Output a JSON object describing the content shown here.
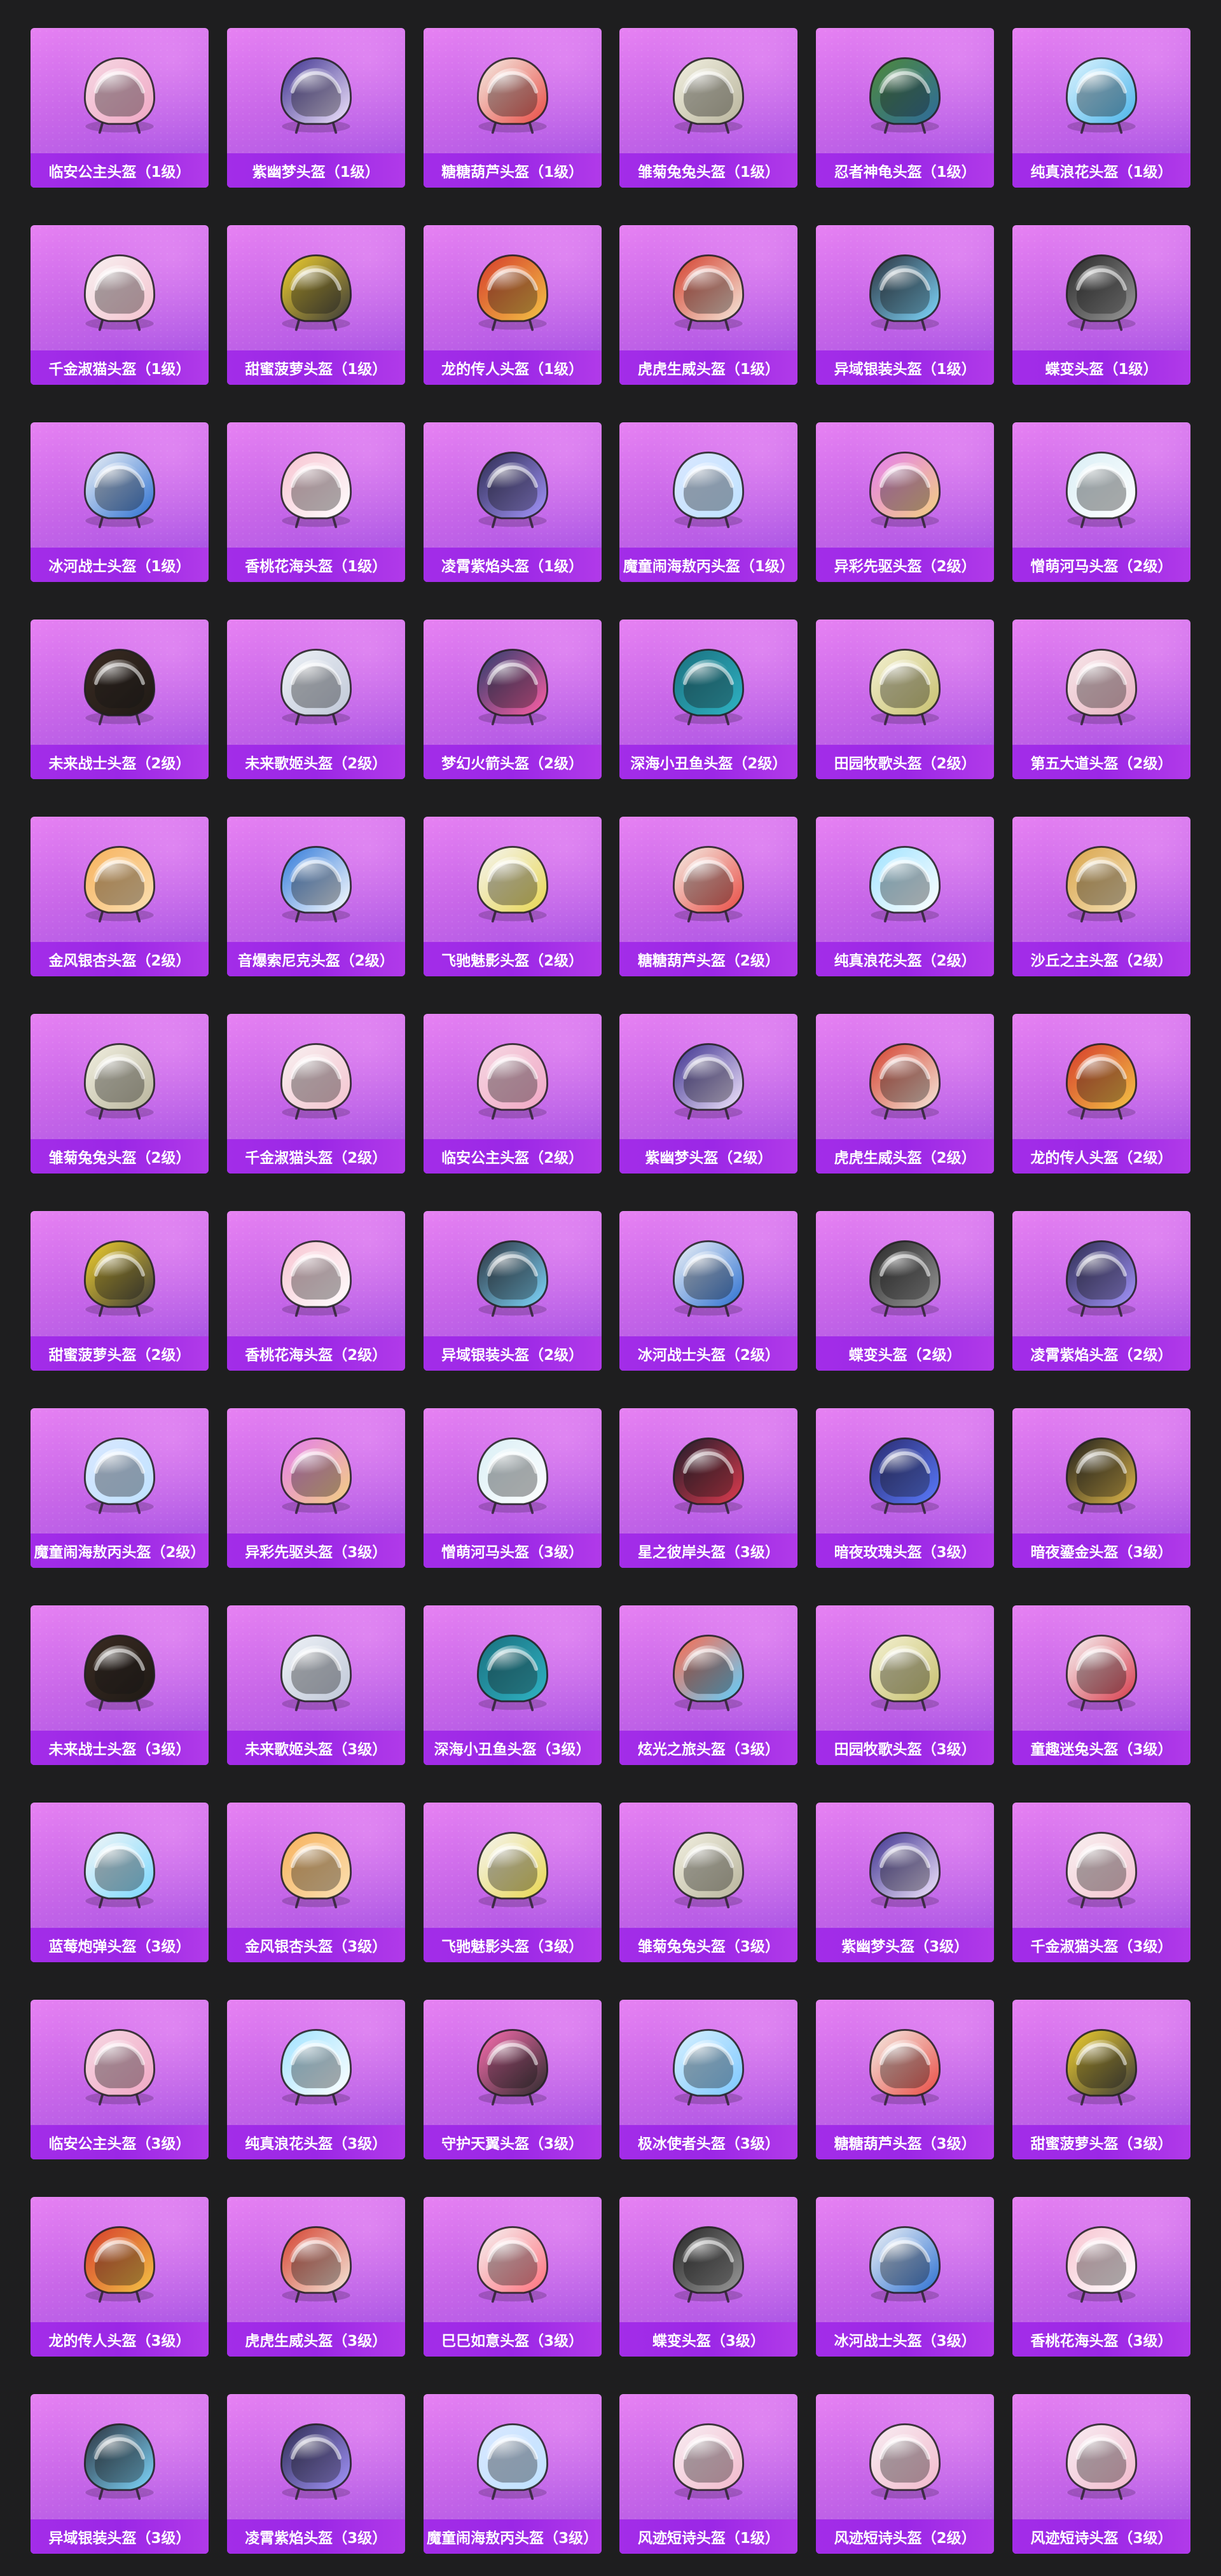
{
  "cards": [
    {
      "label": "临安公主头盔（1级）",
      "icon": "helmet-icon",
      "colors": [
        "#f6d8e3",
        "#f0a7c4"
      ]
    },
    {
      "label": "紫幽梦头盔（1级）",
      "icon": "helmet-icon",
      "colors": [
        "#3b2f8d",
        "#f3e7ff"
      ]
    },
    {
      "label": "糖糖葫芦头盔（1级）",
      "icon": "helmet-icon",
      "colors": [
        "#f4efe7",
        "#e94b43"
      ]
    },
    {
      "label": "雏菊兔兔头盔（1级）",
      "icon": "helmet-icon",
      "colors": [
        "#f2f0e1",
        "#b8b49c"
      ]
    },
    {
      "label": "忍者神龟头盔（1级）",
      "icon": "helmet-icon",
      "colors": [
        "#4f8a3a",
        "#2e6b9d"
      ]
    },
    {
      "label": "纯真浪花头盔（1级）",
      "icon": "helmet-icon",
      "colors": [
        "#dff5ff",
        "#4bb4ea"
      ]
    },
    {
      "label": "千金淑猫头盔（1级）",
      "icon": "helmet-icon",
      "colors": [
        "#f8f1f1",
        "#f4c3cf"
      ]
    },
    {
      "label": "甜蜜菠萝头盔（1级）",
      "icon": "helmet-icon",
      "colors": [
        "#f2d12d",
        "#3a3a3a"
      ]
    },
    {
      "label": "龙的传人头盔（1级）",
      "icon": "helmet-icon",
      "colors": [
        "#d63a2c",
        "#f3c545"
      ]
    },
    {
      "label": "虎虎生威头盔（1级）",
      "icon": "helmet-icon",
      "colors": [
        "#d43f2d",
        "#f5e9dc"
      ]
    },
    {
      "label": "异域银装头盔（1级）",
      "icon": "helmet-icon",
      "colors": [
        "#2a2f3a",
        "#7fd9ff"
      ]
    },
    {
      "label": "蝶变头盔（1级）",
      "icon": "helmet-icon",
      "colors": [
        "#262626",
        "#9a9a9a"
      ]
    },
    {
      "label": "冰河战士头盔（1级）",
      "icon": "helmet-icon",
      "colors": [
        "#f1f4f7",
        "#2b6fd1"
      ]
    },
    {
      "label": "香桃花海头盔（1级）",
      "icon": "helmet-icon",
      "colors": [
        "#f7c3d0",
        "#ffffff"
      ]
    },
    {
      "label": "凌霄紫焰头盔（1级）",
      "icon": "helmet-icon",
      "colors": [
        "#2b2a4e",
        "#a596ff"
      ]
    },
    {
      "label": "魔童闹海敖丙头盔（1级）",
      "icon": "helmet-icon",
      "colors": [
        "#d9e7ff",
        "#bfe2ff"
      ]
    },
    {
      "label": "异彩先驱头盔（2级）",
      "icon": "helmet-icon",
      "colors": [
        "#e57df0",
        "#f2d17f"
      ]
    },
    {
      "label": "憎萌河马头盔（2级）",
      "icon": "helmet-icon",
      "colors": [
        "#d9eef5",
        "#ffffff"
      ]
    },
    {
      "label": "未来战士头盔（2级）",
      "icon": "helmet-icon",
      "colors": [
        "#3a2b22",
        "#1f1a16"
      ]
    },
    {
      "label": "未来歌姬头盔（2级）",
      "icon": "helmet-icon",
      "colors": [
        "#eef2f7",
        "#bfc7d7"
      ]
    },
    {
      "label": "梦幻火箭头盔（2级）",
      "icon": "helmet-icon",
      "colors": [
        "#2a3c6b",
        "#ff5fa5"
      ]
    },
    {
      "label": "深海小丑鱼头盔（2级）",
      "icon": "helmet-icon",
      "colors": [
        "#1a6f7e",
        "#2fb4c5"
      ]
    },
    {
      "label": "田园牧歌头盔（2级）",
      "icon": "helmet-icon",
      "colors": [
        "#f4f1d3",
        "#c7c06e"
      ]
    },
    {
      "label": "第五大道头盔（2级）",
      "icon": "helmet-icon",
      "colors": [
        "#f7e6ea",
        "#e7b3bf"
      ]
    },
    {
      "label": "金风银杏头盔（2级）",
      "icon": "helmet-icon",
      "colors": [
        "#f7b15b",
        "#fbe1b4"
      ]
    },
    {
      "label": "音爆索尼克头盔（2级）",
      "icon": "helmet-icon",
      "colors": [
        "#2e78d9",
        "#ffffff"
      ]
    },
    {
      "label": "飞驰魅影头盔（2级）",
      "icon": "helmet-icon",
      "colors": [
        "#f5f5f5",
        "#e8d64f"
      ]
    },
    {
      "label": "糖糖葫芦头盔（2级）",
      "icon": "helmet-icon",
      "colors": [
        "#f4efe7",
        "#e94b43"
      ]
    },
    {
      "label": "纯真浪花头盔（2级）",
      "icon": "helmet-icon",
      "colors": [
        "#9fe2ff",
        "#ffffff"
      ]
    },
    {
      "label": "沙丘之主头盔（2级）",
      "icon": "helmet-icon",
      "colors": [
        "#d9a44b",
        "#f5e2b8"
      ]
    },
    {
      "label": "雏菊兔兔头盔（2级）",
      "icon": "helmet-icon",
      "colors": [
        "#f2f0e1",
        "#b8b49c"
      ]
    },
    {
      "label": "千金淑猫头盔（2级）",
      "icon": "helmet-icon",
      "colors": [
        "#f8f1f1",
        "#f4c3cf"
      ]
    },
    {
      "label": "临安公主头盔（2级）",
      "icon": "helmet-icon",
      "colors": [
        "#f6d8e3",
        "#f0a7c4"
      ]
    },
    {
      "label": "紫幽梦头盔（2级）",
      "icon": "helmet-icon",
      "colors": [
        "#3b2f8d",
        "#f3e7ff"
      ]
    },
    {
      "label": "虎虎生威头盔（2级）",
      "icon": "helmet-icon",
      "colors": [
        "#d43f2d",
        "#f5e9dc"
      ]
    },
    {
      "label": "龙的传人头盔（2级）",
      "icon": "helmet-icon",
      "colors": [
        "#d63a2c",
        "#f3c545"
      ]
    },
    {
      "label": "甜蜜菠萝头盔（2级）",
      "icon": "helmet-icon",
      "colors": [
        "#f2d12d",
        "#3a3a3a"
      ]
    },
    {
      "label": "香桃花海头盔（2级）",
      "icon": "helmet-icon",
      "colors": [
        "#f7c3d0",
        "#ffffff"
      ]
    },
    {
      "label": "异域银装头盔（2级）",
      "icon": "helmet-icon",
      "colors": [
        "#2a2f3a",
        "#7fd9ff"
      ]
    },
    {
      "label": "冰河战士头盔（2级）",
      "icon": "helmet-icon",
      "colors": [
        "#f1f4f7",
        "#2b6fd1"
      ]
    },
    {
      "label": "蝶变头盔（2级）",
      "icon": "helmet-icon",
      "colors": [
        "#262626",
        "#9a9a9a"
      ]
    },
    {
      "label": "凌霄紫焰头盔（2级）",
      "icon": "helmet-icon",
      "colors": [
        "#2b2a4e",
        "#a596ff"
      ]
    },
    {
      "label": "魔童闹海敖丙头盔（2级）",
      "icon": "helmet-icon",
      "colors": [
        "#d9e7ff",
        "#bfe2ff"
      ]
    },
    {
      "label": "异彩先驱头盔（3级）",
      "icon": "helmet-icon",
      "colors": [
        "#e57df0",
        "#f2d17f"
      ]
    },
    {
      "label": "憎萌河马头盔（3级）",
      "icon": "helmet-icon",
      "colors": [
        "#d9eef5",
        "#ffffff"
      ]
    },
    {
      "label": "星之彼岸头盔（3级）",
      "icon": "helmet-icon",
      "colors": [
        "#1d1c2a",
        "#e03b4f"
      ]
    },
    {
      "label": "暗夜玫瑰头盔（3级）",
      "icon": "helmet-icon",
      "colors": [
        "#2a2a6d",
        "#5a7bff"
      ]
    },
    {
      "label": "暗夜鎏金头盔（3级）",
      "icon": "helmet-icon",
      "colors": [
        "#1b1b1b",
        "#e1b94a"
      ]
    },
    {
      "label": "未来战士头盔（3级）",
      "icon": "helmet-icon",
      "colors": [
        "#3a2b22",
        "#1f1a16"
      ]
    },
    {
      "label": "未来歌姬头盔（3级）",
      "icon": "helmet-icon",
      "colors": [
        "#eef2f7",
        "#bfc7d7"
      ]
    },
    {
      "label": "深海小丑鱼头盔（3级）",
      "icon": "helmet-icon",
      "colors": [
        "#1a6f7e",
        "#2fb4c5"
      ]
    },
    {
      "label": "炫光之旅头盔（3级）",
      "icon": "helmet-icon",
      "colors": [
        "#ff6a4d",
        "#5fd0ff"
      ]
    },
    {
      "label": "田园牧歌头盔（3级）",
      "icon": "helmet-icon",
      "colors": [
        "#f4f1d3",
        "#c7c06e"
      ]
    },
    {
      "label": "童趣迷兔头盔（3级）",
      "icon": "helmet-icon",
      "colors": [
        "#f7f7f7",
        "#d73b4b"
      ]
    },
    {
      "label": "蓝莓炮弹头盔（3级）",
      "icon": "helmet-icon",
      "colors": [
        "#f6f6f6",
        "#78d8ff"
      ]
    },
    {
      "label": "金风银杏头盔（3级）",
      "icon": "helmet-icon",
      "colors": [
        "#f7b15b",
        "#fbe1b4"
      ]
    },
    {
      "label": "飞驰魅影头盔（3级）",
      "icon": "helmet-icon",
      "colors": [
        "#f5f5f5",
        "#e8d64f"
      ]
    },
    {
      "label": "雏菊兔兔头盔（3级）",
      "icon": "helmet-icon",
      "colors": [
        "#f2f0e1",
        "#b8b49c"
      ]
    },
    {
      "label": "紫幽梦头盔（3级）",
      "icon": "helmet-icon",
      "colors": [
        "#3b2f8d",
        "#f3e7ff"
      ]
    },
    {
      "label": "千金淑猫头盔（3级）",
      "icon": "helmet-icon",
      "colors": [
        "#f8f1f1",
        "#f4c3cf"
      ]
    },
    {
      "label": "临安公主头盔（3级）",
      "icon": "helmet-icon",
      "colors": [
        "#f6d8e3",
        "#f0a7c4"
      ]
    },
    {
      "label": "纯真浪花头盔（3级）",
      "icon": "helmet-icon",
      "colors": [
        "#9fe2ff",
        "#ffffff"
      ]
    },
    {
      "label": "守护天翼头盔（3级）",
      "icon": "helmet-icon",
      "colors": [
        "#ff6eb3",
        "#2b2b2b"
      ]
    },
    {
      "label": "极冰使者头盔（3级）",
      "icon": "helmet-icon",
      "colors": [
        "#d7f1ff",
        "#7cc7ff"
      ]
    },
    {
      "label": "糖糖葫芦头盔（3级）",
      "icon": "helmet-icon",
      "colors": [
        "#f4efe7",
        "#e94b43"
      ]
    },
    {
      "label": "甜蜜菠萝头盔（3级）",
      "icon": "helmet-icon",
      "colors": [
        "#f2d12d",
        "#3a3a3a"
      ]
    },
    {
      "label": "龙的传人头盔（3级）",
      "icon": "helmet-icon",
      "colors": [
        "#d63a2c",
        "#f3c545"
      ]
    },
    {
      "label": "虎虎生威头盔（3级）",
      "icon": "helmet-icon",
      "colors": [
        "#d43f2d",
        "#f5e9dc"
      ]
    },
    {
      "label": "巳巳如意头盔（3级）",
      "icon": "helmet-icon",
      "colors": [
        "#f5f5f5",
        "#ff6f7b"
      ]
    },
    {
      "label": "蝶变头盔（3级）",
      "icon": "helmet-icon",
      "colors": [
        "#262626",
        "#9a9a9a"
      ]
    },
    {
      "label": "冰河战士头盔（3级）",
      "icon": "helmet-icon",
      "colors": [
        "#f1f4f7",
        "#2b6fd1"
      ]
    },
    {
      "label": "香桃花海头盔（3级）",
      "icon": "helmet-icon",
      "colors": [
        "#f7c3d0",
        "#ffffff"
      ]
    },
    {
      "label": "异域银装头盔（3级）",
      "icon": "helmet-icon",
      "colors": [
        "#2a2f3a",
        "#7fd9ff"
      ]
    },
    {
      "label": "凌霄紫焰头盔（3级）",
      "icon": "helmet-icon",
      "colors": [
        "#2b2a4e",
        "#a596ff"
      ]
    },
    {
      "label": "魔童闹海敖丙头盔（3级）",
      "icon": "helmet-icon",
      "colors": [
        "#d9e7ff",
        "#bfe2ff"
      ]
    },
    {
      "label": "风迹短诗头盔（1级）",
      "icon": "helmet-icon",
      "colors": [
        "#f8eef3",
        "#f2b9cc"
      ]
    },
    {
      "label": "风迹短诗头盔（2级）",
      "icon": "helmet-icon",
      "colors": [
        "#f8eef3",
        "#f2b9cc"
      ]
    },
    {
      "label": "风迹短诗头盔（3级）",
      "icon": "helmet-icon",
      "colors": [
        "#f8eef3",
        "#f2b9cc"
      ]
    }
  ]
}
